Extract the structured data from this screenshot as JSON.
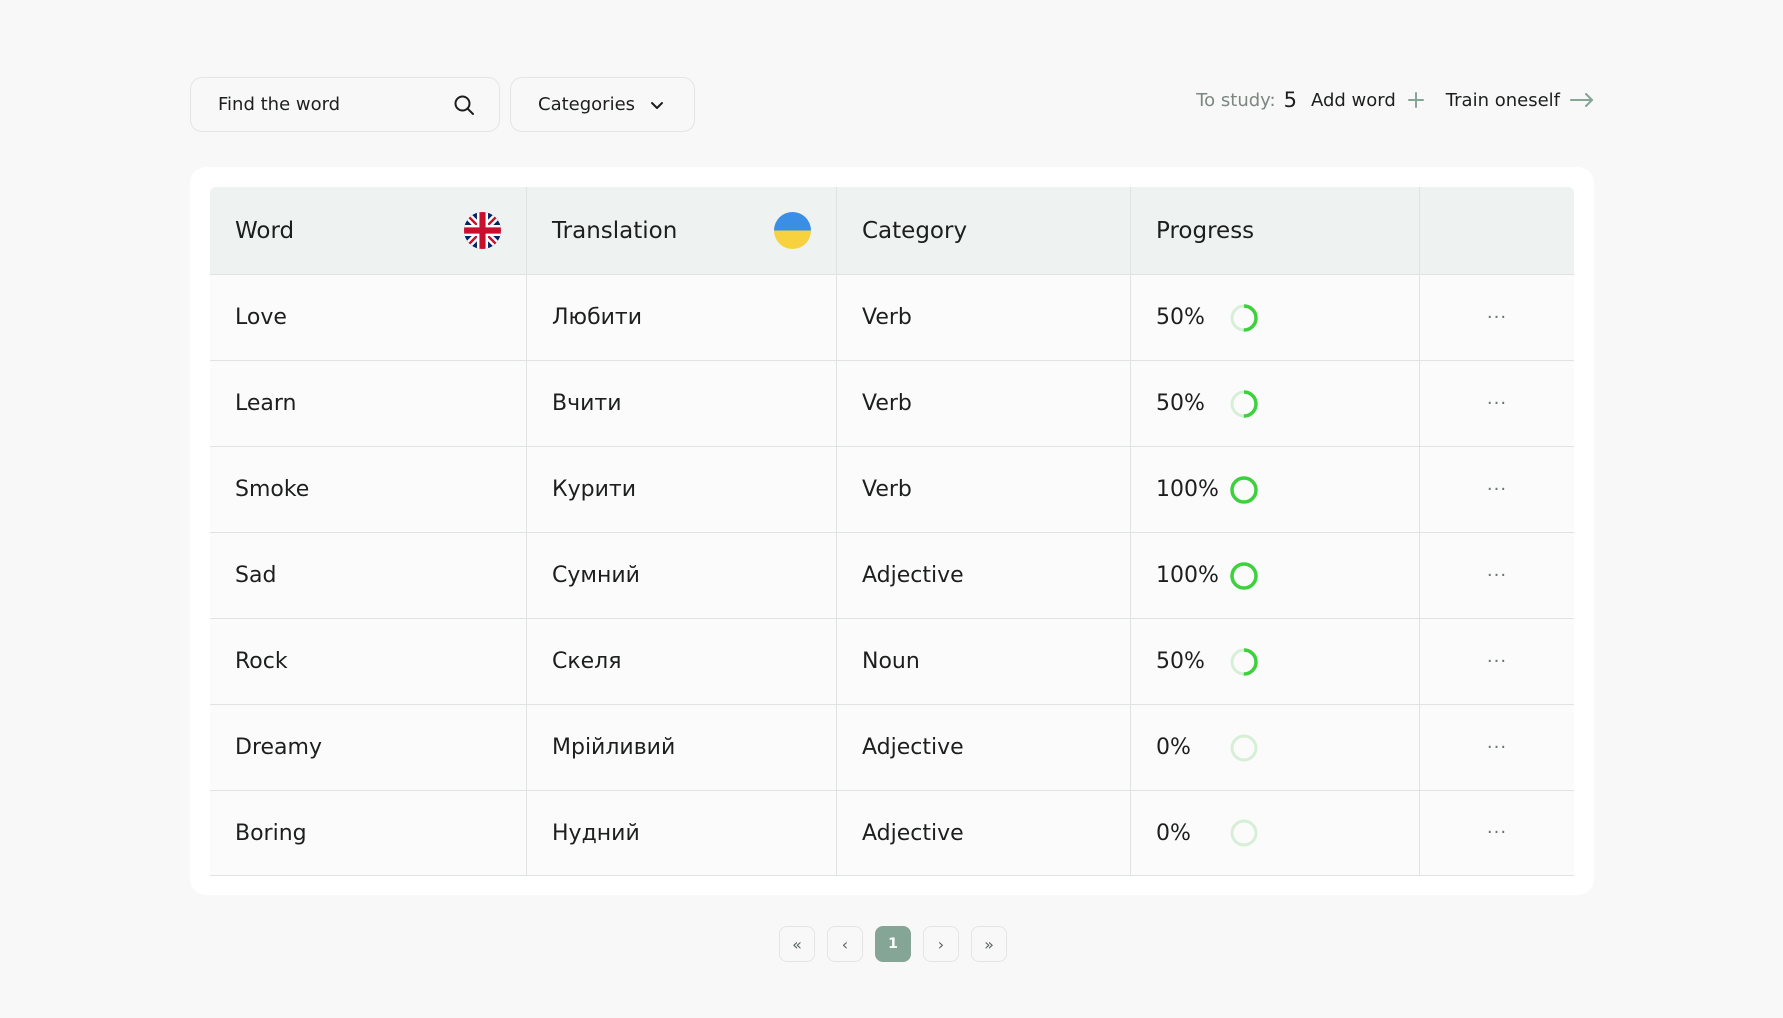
{
  "search": {
    "placeholder": "Find the word",
    "icon": "search-icon"
  },
  "categories": {
    "label": "Categories",
    "icon": "chevron-down-icon"
  },
  "toolbar": {
    "to_study_label": "To study:",
    "to_study_count": "5",
    "add_word_label": "Add word",
    "train_label": "Train oneself"
  },
  "table": {
    "headers": {
      "word": "Word",
      "translation": "Translation",
      "category": "Category",
      "progress": "Progress"
    },
    "rows": [
      {
        "word": "Love",
        "translation": "Любити",
        "category": "Verb",
        "progress_label": "50%",
        "progress": 0.5,
        "more": "···"
      },
      {
        "word": "Learn",
        "translation": "Вчити",
        "category": "Verb",
        "progress_label": "50%",
        "progress": 0.5,
        "more": "···"
      },
      {
        "word": "Smoke",
        "translation": "Курити",
        "category": "Verb",
        "progress_label": "100%",
        "progress": 1.0,
        "more": "···"
      },
      {
        "word": "Sad",
        "translation": "Сумний",
        "category": "Adjective",
        "progress_label": "100%",
        "progress": 1.0,
        "more": "···"
      },
      {
        "word": "Rock",
        "translation": "Скеля",
        "category": "Noun",
        "progress_label": "50%",
        "progress": 0.5,
        "more": "···"
      },
      {
        "word": "Dreamy",
        "translation": "Мрійливий",
        "category": "Adjective",
        "progress_label": "0%",
        "progress": 0.0,
        "more": "···"
      },
      {
        "word": "Boring",
        "translation": "Нудний",
        "category": "Adjective",
        "progress_label": "0%",
        "progress": 0.0,
        "more": "···"
      }
    ]
  },
  "pagination": {
    "first": "«",
    "prev": "‹",
    "current": "1",
    "next": "›",
    "last": "»"
  },
  "colors": {
    "progress_ring": "#3ed13e",
    "progress_track": "#d6efd6",
    "active_page": "#85a597"
  }
}
